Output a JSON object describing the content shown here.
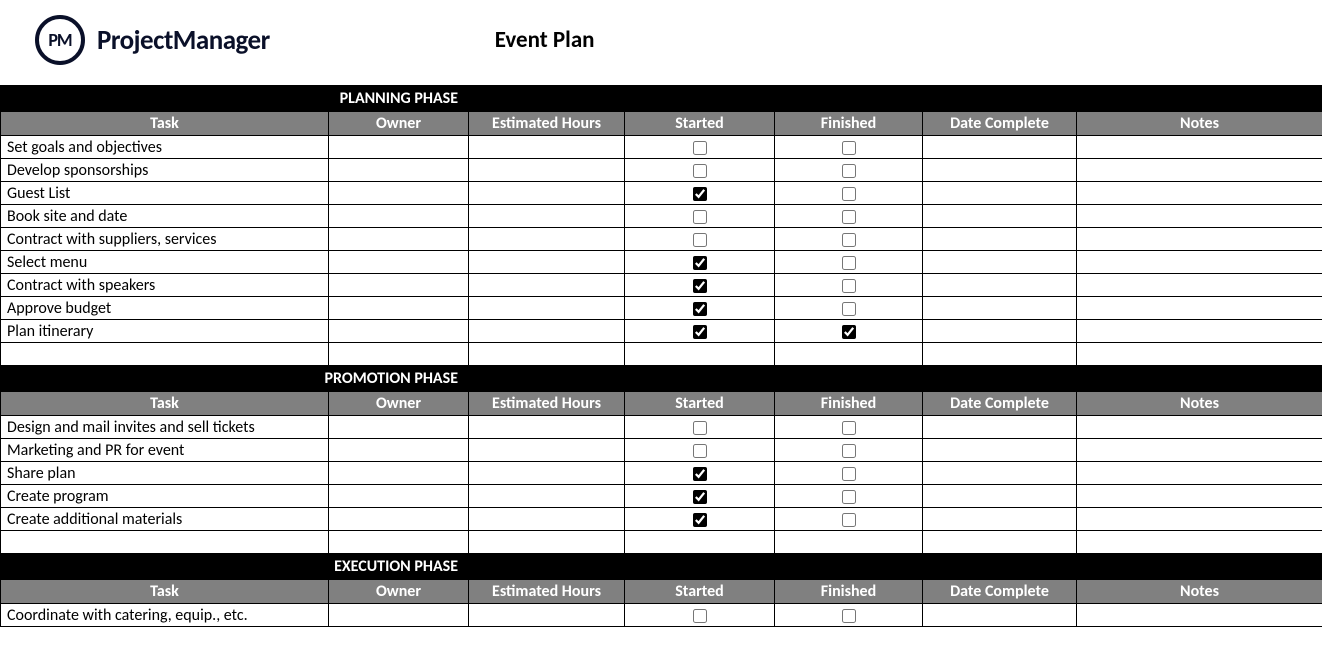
{
  "brand": {
    "logo_initials": "PM",
    "logo_text": "ProjectManager"
  },
  "title": "Event Plan",
  "columns": {
    "task": "Task",
    "owner": "Owner",
    "hours": "Estimated Hours",
    "started": "Started",
    "finished": "Finished",
    "date": "Date Complete",
    "notes": "Notes"
  },
  "phases": [
    {
      "name": "PLANNING PHASE",
      "rows": [
        {
          "task": "Set goals and objectives",
          "started": false,
          "finished": false
        },
        {
          "task": "Develop sponsorships",
          "started": false,
          "finished": false
        },
        {
          "task": "Guest List",
          "started": true,
          "finished": false
        },
        {
          "task": "Book site and date",
          "started": false,
          "finished": false
        },
        {
          "task": "Contract with suppliers, services",
          "started": false,
          "finished": false
        },
        {
          "task": "Select menu",
          "started": true,
          "finished": false
        },
        {
          "task": "Contract with speakers",
          "started": true,
          "finished": false
        },
        {
          "task": "Approve budget",
          "started": true,
          "finished": false
        },
        {
          "task": "Plan itinerary",
          "started": true,
          "finished": true
        }
      ],
      "trailing_blank_rows": 1
    },
    {
      "name": "PROMOTION PHASE",
      "rows": [
        {
          "task": "Design and mail invites and sell tickets",
          "started": false,
          "finished": false
        },
        {
          "task": "Marketing and PR for event",
          "started": false,
          "finished": false
        },
        {
          "task": "Share plan",
          "started": true,
          "finished": false
        },
        {
          "task": "Create program",
          "started": true,
          "finished": false
        },
        {
          "task": "Create additional materials",
          "started": true,
          "finished": false
        }
      ],
      "trailing_blank_rows": 1
    },
    {
      "name": "EXECUTION PHASE",
      "rows": [
        {
          "task": "Coordinate with catering, equip., etc.",
          "started": false,
          "finished": false
        }
      ],
      "trailing_blank_rows": 0
    }
  ]
}
